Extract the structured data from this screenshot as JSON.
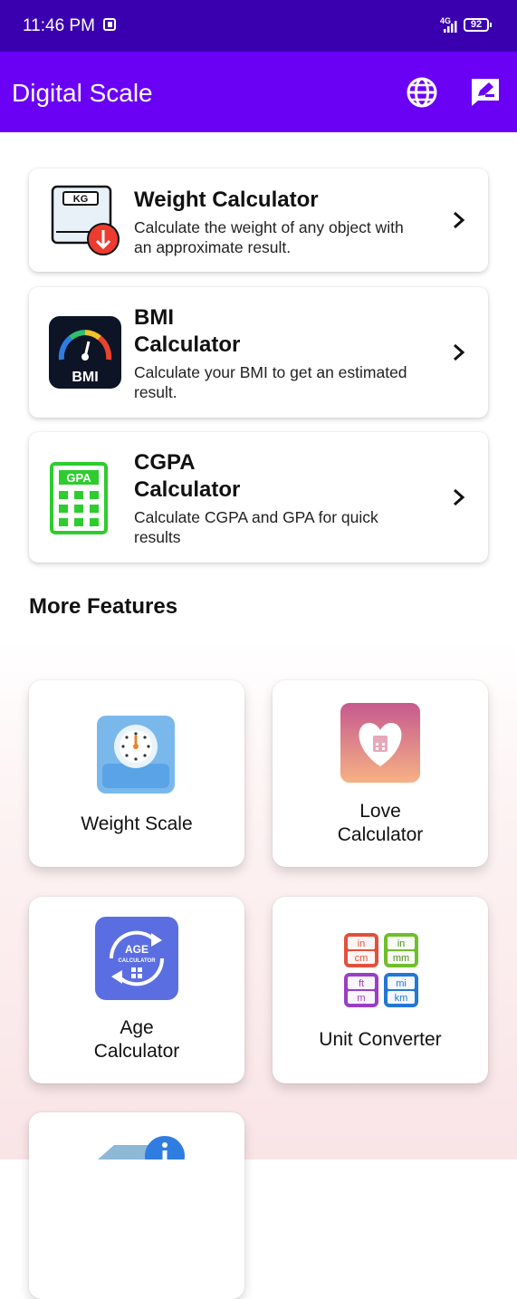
{
  "status": {
    "time": "11:46 PM",
    "network": "4G",
    "battery": "92"
  },
  "appbar": {
    "title": "Digital Scale",
    "language_icon": "globe-icon",
    "feedback_icon": "feedback-icon"
  },
  "features": [
    {
      "title": "Weight Calculator",
      "desc": "Calculate the weight of any object with an approximate result.",
      "icon": "kg-scale-icon"
    },
    {
      "title": "BMI\nCalculator",
      "desc": "Calculate your BMI to get an estimated result.",
      "icon": "bmi-gauge-icon"
    },
    {
      "title": "CGPA\nCalculator",
      "desc": "Calculate CGPA and GPA for quick results",
      "icon": "gpa-calculator-icon"
    }
  ],
  "more_features": {
    "title": "More Features",
    "items": [
      {
        "label": "Weight Scale",
        "icon": "weight-scale-icon"
      },
      {
        "label": "Love\nCalculator",
        "icon": "love-calculator-icon"
      },
      {
        "label": "Age\nCalculator",
        "icon": "age-calculator-icon",
        "icon_text_main": "AGE",
        "icon_text_sub": "CALCULATOR"
      },
      {
        "label": "Unit Converter",
        "icon": "unit-converter-icon",
        "units": [
          "in",
          "cm",
          "in",
          "mm",
          "ft",
          "m",
          "mi",
          "km"
        ]
      }
    ]
  },
  "colors": {
    "status_bar": "#3a00b0",
    "app_bar": "#6a00f4",
    "gpa_green": "#2ecc2e",
    "age_blue": "#5b6ee1"
  }
}
